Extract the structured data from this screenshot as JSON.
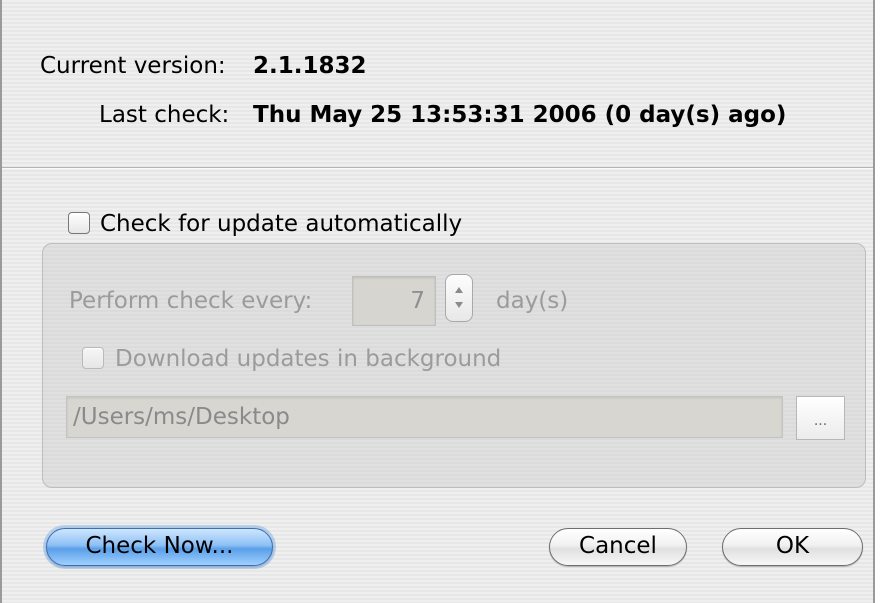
{
  "info": {
    "current_version_label": "Current version:",
    "current_version_value": "2.1.1832",
    "last_check_label": "Last check:",
    "last_check_value": "Thu May 25 13:53:31 2006 (0 day(s) ago)"
  },
  "auto_check": {
    "label": "Check for update automatically",
    "checked": false
  },
  "schedule": {
    "perform_label": "Perform check every:",
    "interval_value": "7",
    "unit_label": "day(s)",
    "enabled": false
  },
  "background_download": {
    "label": "Download updates in background",
    "checked": false,
    "enabled": false
  },
  "download_path": {
    "value": "/Users/ms/Desktop",
    "browse_label": "..."
  },
  "buttons": {
    "check_now": "Check Now...",
    "cancel": "Cancel",
    "ok": "OK"
  },
  "icons": {
    "stepper": "up-down-arrows-icon"
  },
  "colors": {
    "default_button": "#5a9fe8",
    "disabled_text": "#9b9b9b"
  }
}
